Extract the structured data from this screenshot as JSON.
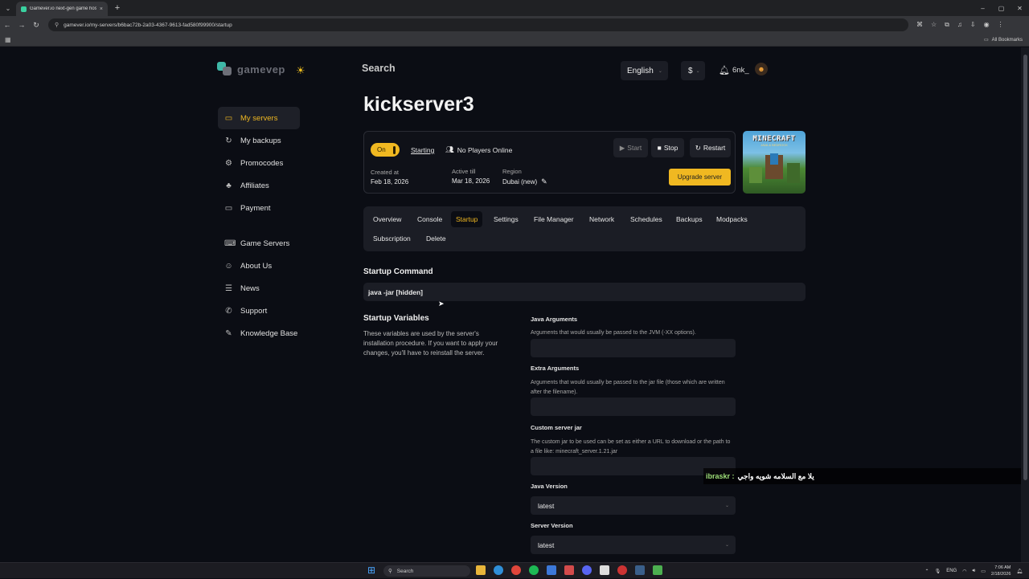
{
  "browser": {
    "tab_title": "Gamever.io next-gen game hos",
    "tab_close": "×",
    "new_tab": "+",
    "url": "gamever.io/my-servers/b6bac72b-2a03-4367-9613-fad580f99900/startup",
    "all_bookmarks": "All Bookmarks",
    "window_controls": [
      "–",
      "▢",
      "✕"
    ]
  },
  "header": {
    "logo_text": "gamevep",
    "search_label": "Search",
    "language": "English",
    "currency": "$",
    "username": "6nk_"
  },
  "sidebar": {
    "items": [
      {
        "label": "My servers",
        "icon": "server-icon",
        "glyph": "▭",
        "active": true
      },
      {
        "label": "My backups",
        "icon": "backup-icon",
        "glyph": "↻",
        "active": false
      },
      {
        "label": "Promocodes",
        "icon": "promo-icon",
        "glyph": "⚙",
        "active": false
      },
      {
        "label": "Affiliates",
        "icon": "affiliates-icon",
        "glyph": "♣",
        "active": false
      },
      {
        "label": "Payment",
        "icon": "payment-icon",
        "glyph": "▭",
        "active": false
      }
    ],
    "items2": [
      {
        "label": "Game Servers",
        "icon": "gamepad-icon",
        "glyph": "⌨"
      },
      {
        "label": "About Us",
        "icon": "info-icon",
        "glyph": "☺"
      },
      {
        "label": "News",
        "icon": "news-icon",
        "glyph": "☰"
      },
      {
        "label": "Support",
        "icon": "support-icon",
        "glyph": "✆"
      },
      {
        "label": "Knowledge Base",
        "icon": "book-icon",
        "glyph": "✎"
      }
    ]
  },
  "server": {
    "name": "kickserver3",
    "toggle_label": "On",
    "status": "Starting",
    "players": "No Players Online",
    "created_label": "Created at",
    "created_value": "Feb 18, 2026",
    "active_label": "Active till",
    "active_value": "Mar 18, 2026",
    "region_label": "Region",
    "region_value": "Dubai (new)",
    "start_label": "Start",
    "stop_label": "Stop",
    "restart_label": "Restart",
    "upgrade_label": "Upgrade server",
    "game_art_title": "MINECRAFT",
    "game_art_subtitle": "JAVA & BEDROCK"
  },
  "tabs": [
    {
      "label": "Overview",
      "active": false
    },
    {
      "label": "Console",
      "active": false
    },
    {
      "label": "Startup",
      "active": true
    },
    {
      "label": "Settings",
      "active": false
    },
    {
      "label": "File Manager",
      "active": false
    },
    {
      "label": "Network",
      "active": false
    },
    {
      "label": "Schedules",
      "active": false
    },
    {
      "label": "Backups",
      "active": false
    },
    {
      "label": "Modpacks",
      "active": false
    },
    {
      "label": "Subscription",
      "active": false
    },
    {
      "label": "Delete",
      "active": false
    }
  ],
  "startup": {
    "command_title": "Startup Command",
    "command_value": "java -jar [hidden]",
    "vars_title": "Startup Variables",
    "vars_desc": "These variables are used by the server's installation procedure. If you want to apply your changes, you'll have to reinstall the server.",
    "java_args_label": "Java Arguments",
    "java_args_desc": "Arguments that would usually be passed to the JVM (-XX options).",
    "extra_args_label": "Extra Arguments",
    "extra_args_desc": "Arguments that would usually be passed to the jar file (those which are written after the filename).",
    "custom_jar_label": "Custom server jar",
    "custom_jar_desc": "The custom jar to be used can be set as either a URL to download or the path to a file like: minecraft_server.1.21.jar",
    "java_version_label": "Java Version",
    "java_version_value": "latest",
    "server_version_label": "Server Version",
    "server_version_value": "latest"
  },
  "overlay": {
    "name": "ibraskr :",
    "message": "يلا مع السلامه شويه واجي"
  },
  "taskbar": {
    "search": "Search",
    "lang": "ENG",
    "time": "7:06 AM",
    "date": "2/18/2026"
  },
  "colors": {
    "accent": "#f0b821",
    "background": "#0b0d14",
    "panel": "#1b1d25"
  }
}
